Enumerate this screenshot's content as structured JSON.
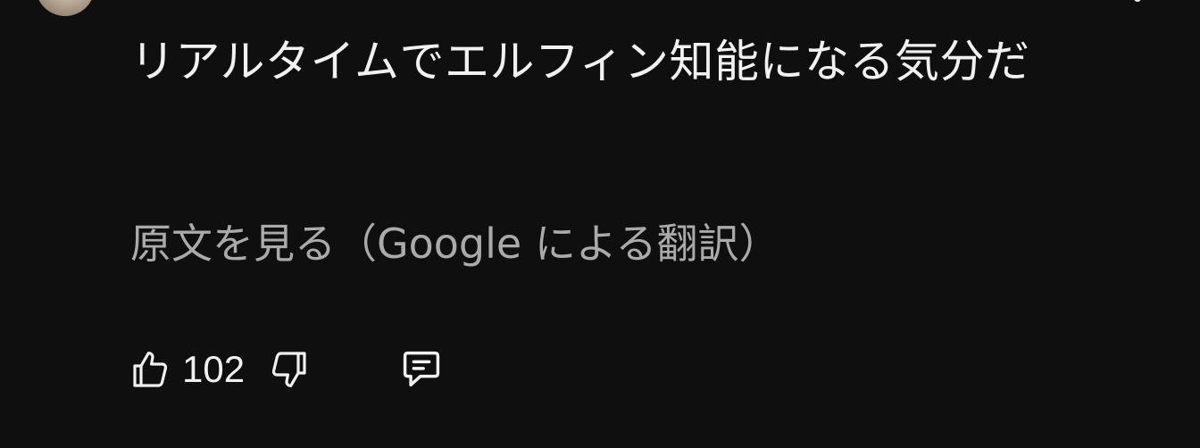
{
  "comment": {
    "text": "リアルタイムでエルフィン知能になる気分だ",
    "translation_link": "原文を見る（Google による翻訳）"
  },
  "actions": {
    "like_count": "102",
    "like_icon": "thumbs-up-icon",
    "dislike_icon": "thumbs-down-icon",
    "reply_icon": "reply-comment-icon"
  },
  "colors": {
    "background": "#0f0f0f",
    "primary_text": "#f1f1f1",
    "secondary_text": "#aaaaaa"
  }
}
